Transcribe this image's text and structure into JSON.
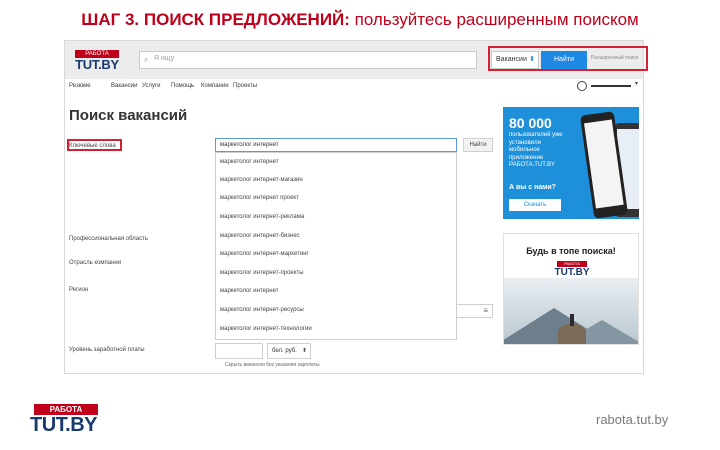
{
  "slide": {
    "title_bold": "ШАГ 3. ПОИСК ПРЕДЛОЖЕНИЙ:",
    "title_rest": " пользуйтесь расширенным поиском",
    "site_url": "rabota.tut.by"
  },
  "logo": {
    "top": "РАБОТА",
    "main": "TUT.BY"
  },
  "header": {
    "search_placeholder": "Я ищу",
    "type_select": "Вакансии",
    "find_button": "Найти",
    "advanced_link": "Расширенный поиск"
  },
  "nav": {
    "items": [
      "Резюме",
      "Вакансии",
      "Услуги",
      "Помощь",
      "Компании",
      "Проекты"
    ]
  },
  "search_form": {
    "title": "Поиск вакансий",
    "keywords_label": "Ключевые слова",
    "keywords_value": "маркетолог интернет",
    "find_button": "Найти",
    "prof_area_label": "Профессиональная область",
    "industry_label": "Отрасль компании",
    "region_label": "Регион",
    "salary_label": "Уровень заработной платы",
    "currency": "бел. руб.",
    "salary_hint": "Скрыть вакансии без указания зарплаты"
  },
  "suggestions": [
    "маркетолог интернет",
    "маркетолог интернет-магазин",
    "маркетолог интернет проект",
    "маркетолог интернет-реклама",
    "маркетолог интернет-бизнес",
    "маркетолог интернет-маркетинг",
    "маркетолог интернет-проекты",
    "маркетолог интернет",
    "маркетолог интернет-ресурсы",
    "маркетолог интернет-технологии"
  ],
  "ad_app": {
    "big": "80 000",
    "text": "пользователей уже установили мобильное приложение РАБОТА.TUT.BY",
    "question": "А вы с нами?",
    "button": "Скачать"
  },
  "ad_top": {
    "title": "Будь в топе поиска!"
  },
  "colors": {
    "accent_red": "#c0001a",
    "highlight": "#d4202f",
    "brand_blue": "#1a3a6e",
    "button_blue": "#1e88e5"
  }
}
